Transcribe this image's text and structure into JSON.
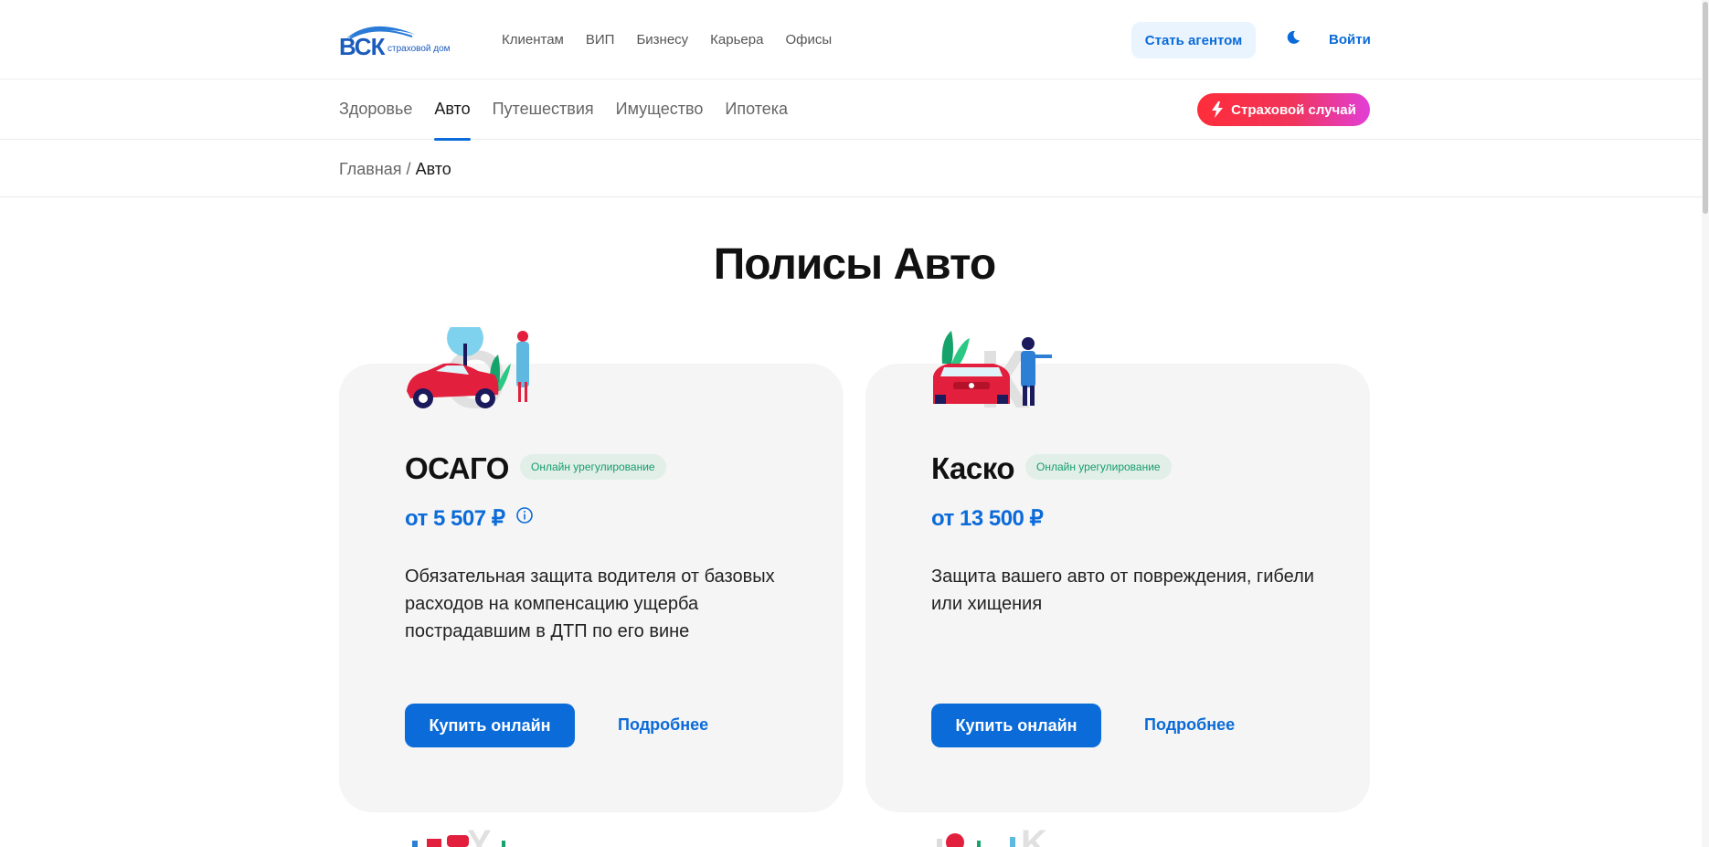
{
  "logo": {
    "mark": "ВСК",
    "sub": "страховой дом"
  },
  "top_nav": [
    "Клиентам",
    "ВИП",
    "Бизнесу",
    "Карьера",
    "Офисы"
  ],
  "header_actions": {
    "agent": "Стать агентом",
    "theme_icon": "moon-icon",
    "login": "Войти"
  },
  "section_nav": {
    "items": [
      "Здоровье",
      "Авто",
      "Путешествия",
      "Имущество",
      "Ипотека"
    ],
    "active": "Авто"
  },
  "claim_button": "Страховой случай",
  "breadcrumb": {
    "home": "Главная",
    "sep": "/",
    "current": "Авто"
  },
  "page_title": "Полисы Авто",
  "cards": [
    {
      "title": "ОСАГО",
      "badge": "Онлайн урегулирование",
      "price": "от 5 507 ₽",
      "description": "Обязательная защита водителя от базовых расходов на компенсацию ущерба пострадавшим в ДТП по его вине",
      "buy": "Купить онлайн",
      "more": "Подробнее"
    },
    {
      "title": "Каско",
      "badge": "Онлайн урегулирование",
      "price": "от 13 500 ₽",
      "description": "Защита вашего авто от повреждения, гибели или хищения",
      "buy": "Купить онлайн",
      "more": "Подробнее"
    }
  ],
  "colors": {
    "accent": "#0b6bd9",
    "badge_text": "#169c6e",
    "claim_gradient_start": "#ff2d3a",
    "claim_gradient_end": "#e23fd8"
  }
}
